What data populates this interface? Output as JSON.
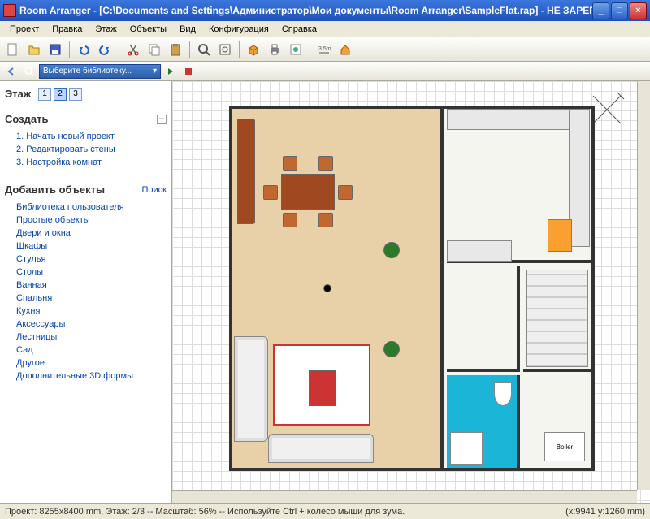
{
  "titlebar": {
    "text": "Room Arranger - [C:\\Documents and Settings\\Администратор\\Мои документы\\Room Arranger\\SampleFlat.rap] - НЕ ЗАРЕГИСТРИРО..."
  },
  "menu": [
    "Проект",
    "Правка",
    "Этаж",
    "Объекты",
    "Вид",
    "Конфигурация",
    "Справка"
  ],
  "search": {
    "placeholder": "Выберите библиотеку..."
  },
  "sidebar": {
    "floor_label": "Этаж",
    "floors": [
      "1",
      "2",
      "3"
    ],
    "active_floor": 1,
    "create_hdr": "Создать",
    "create_items": [
      "1. Начать новый проект",
      "2. Редактировать стены",
      "3. Настройка комнат"
    ],
    "add_hdr": "Добавить объекты",
    "search_label": "Поиск",
    "categories": [
      "Библиотека пользователя",
      "Простые объекты",
      "Двери и окна",
      "Шкафы",
      "Стулья",
      "Столы",
      "Ванная",
      "Спальня",
      "Кухня",
      "Аксессуары",
      "Лестницы",
      "Сад",
      "Другое",
      "Дополнительные 3D формы"
    ]
  },
  "plan": {
    "boiler_label": "Boiler"
  },
  "status": {
    "left": "Проект: 8255x8400 mm, Этаж: 2/3 -- Масштаб: 56% -- Используйте Ctrl + колесо мыши для зума.",
    "right": "(x:9941 y:1260 mm)"
  }
}
